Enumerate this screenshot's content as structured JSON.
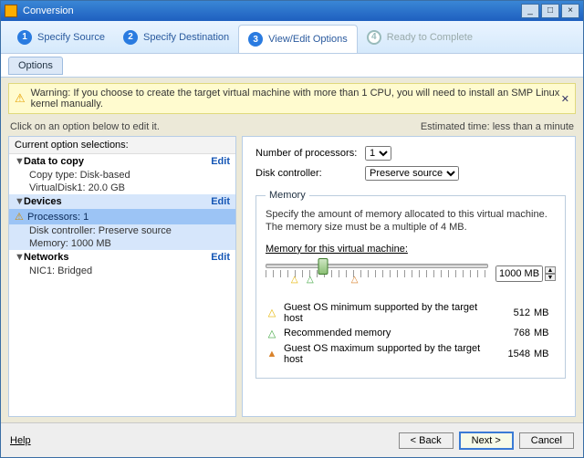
{
  "window": {
    "title": "Conversion"
  },
  "steps": [
    {
      "num": "1",
      "label": "Specify Source"
    },
    {
      "num": "2",
      "label": "Specify Destination"
    },
    {
      "num": "3",
      "label": "View/Edit Options"
    },
    {
      "num": "4",
      "label": "Ready to Complete"
    }
  ],
  "subtab": "Options",
  "warning_text": "Warning: If you choose to create the target virtual machine with more than 1 CPU, you will need to install an SMP Linux kernel manually.",
  "hint": "Click on an option below to edit it.",
  "estimated_label": "Estimated time:",
  "estimated_value": "less than a minute",
  "left": {
    "header": "Current option selections:",
    "edit": "Edit",
    "data_to_copy": {
      "title": "Data to copy",
      "copy_type": "Copy type: Disk-based",
      "disk": "VirtualDisk1: 20.0 GB"
    },
    "devices": {
      "title": "Devices",
      "processors": "Processors: 1",
      "disk_controller": "Disk controller: Preserve source",
      "memory": "Memory: 1000 MB"
    },
    "networks": {
      "title": "Networks",
      "nic": "NIC1: Bridged"
    }
  },
  "right": {
    "num_proc_label": "Number of processors:",
    "num_proc_value": "1",
    "disk_ctrl_label": "Disk controller:",
    "disk_ctrl_value": "Preserve source",
    "memory_group": "Memory",
    "memory_desc": "Specify the amount of memory allocated to this virtual machine. The memory size must be a multiple of 4 MB.",
    "memory_label": "Memory for this virtual machine:",
    "memory_value": "1000 MB",
    "legend": {
      "min": {
        "text": "Guest OS minimum supported by the target host",
        "value": "512",
        "unit": "MB"
      },
      "rec": {
        "text": "Recommended memory",
        "value": "768",
        "unit": "MB"
      },
      "max": {
        "text": "Guest OS maximum supported by the target host",
        "value": "1548",
        "unit": "MB"
      }
    }
  },
  "footer": {
    "help": "Help",
    "back": "< Back",
    "next": "Next >",
    "cancel": "Cancel"
  }
}
